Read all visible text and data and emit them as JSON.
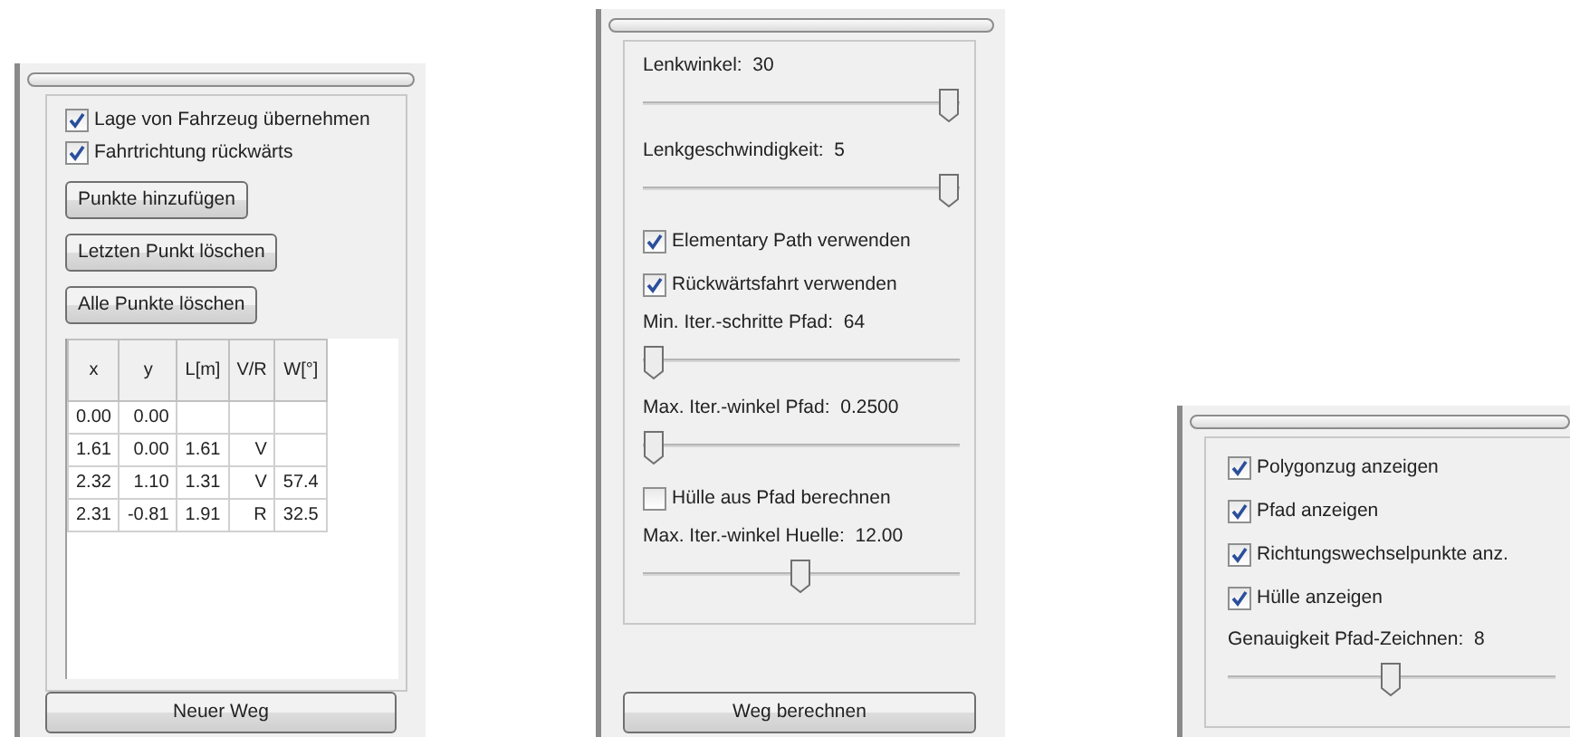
{
  "panels": [
    {
      "items": [
        {
          "kind": "checkbox",
          "label": "Lage von Fahrzeug übernehmen",
          "checked": true
        },
        {
          "kind": "checkbox",
          "label": "Fahrtrichtung rückwärts",
          "checked": true
        },
        {
          "kind": "button",
          "label": "Punkte hinzufügen"
        },
        {
          "kind": "button",
          "label": "Letzten Punkt löschen"
        },
        {
          "kind": "button",
          "label": "Alle Punkte löschen"
        }
      ],
      "table": {
        "columns": [
          "x",
          "y",
          "L[m]",
          "V/R",
          "W[°]"
        ],
        "rows": [
          [
            "0.00",
            "0.00",
            "",
            "",
            ""
          ],
          [
            "1.61",
            "0.00",
            "1.61",
            "V",
            ""
          ],
          [
            "2.32",
            "1.10",
            "1.31",
            "V",
            "57.4"
          ],
          [
            "2.31",
            "-0.81",
            "1.91",
            "R",
            "32.5"
          ]
        ]
      },
      "footer_button": "Neuer Weg"
    },
    {
      "items": [
        {
          "kind": "slider",
          "label": "Lenkwinkel:  30",
          "level": 1
        },
        {
          "kind": "slider",
          "label": "Lenkgeschwindigkeit:  5",
          "level": 1
        },
        {
          "kind": "checkbox",
          "label": "Elementary Path verwenden",
          "checked": true
        },
        {
          "kind": "checkbox",
          "label": "Rückwärtsfahrt verwenden",
          "checked": true
        },
        {
          "kind": "slider",
          "label": "Min. Iter.-schritte Pfad:  64",
          "level": 0
        },
        {
          "kind": "slider",
          "label": "Max. Iter.-winkel Pfad:  0.2500",
          "level": 0
        },
        {
          "kind": "checkbox",
          "label": "Hülle aus Pfad berechnen",
          "checked": false
        },
        {
          "kind": "slider",
          "label": "Max. Iter.-winkel Huelle:  12.00",
          "level": 0.5
        }
      ],
      "footer_button": "Weg berechnen"
    },
    {
      "items": [
        {
          "kind": "checkbox",
          "label": "Polygonzug anzeigen",
          "checked": true
        },
        {
          "kind": "checkbox",
          "label": "Pfad anzeigen",
          "checked": true
        },
        {
          "kind": "checkbox",
          "label": "Richtungswechselpunkte anz.",
          "checked": true
        },
        {
          "kind": "checkbox",
          "label": "Hülle anzeigen",
          "checked": true
        },
        {
          "kind": "slider",
          "label": "Genauigkeit Pfad-Zeichnen:  8",
          "level": 0.5
        }
      ]
    }
  ]
}
